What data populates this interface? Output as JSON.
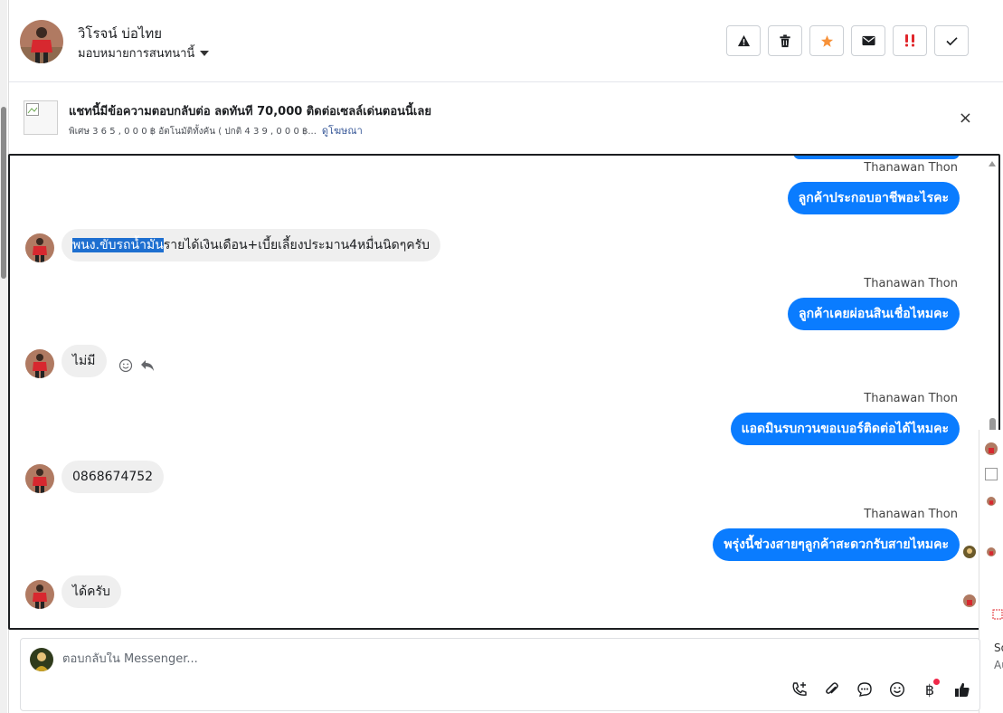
{
  "header": {
    "contact_name": "วิโรจน์ บ่อไทย",
    "assign_label": "มอบหมายการสนทนานี้",
    "actions": [
      {
        "name": "spam-button",
        "icon": "warning-icon"
      },
      {
        "name": "delete-button",
        "icon": "trash-icon"
      },
      {
        "name": "star-button",
        "icon": "star-icon"
      },
      {
        "name": "mark-unread-button",
        "icon": "envelope-icon"
      },
      {
        "name": "follow-up-button",
        "icon": "follow-up-icon"
      },
      {
        "name": "done-button",
        "icon": "check-icon"
      }
    ]
  },
  "ad": {
    "title": "แชทนี้มีข้อความตอบกลับต่อ ลดทันที 70,000 ติดต่อเซลล์เด่นตอนนี้เลย",
    "subtitle": "พิเศษ 3 6 5 , 0 0 0 ฿ อัตโนมัติทั้งคัน ( ปกติ 4 3 9 , 0 0 0 ฿...",
    "link": "ดูโฆษณา",
    "close": "×"
  },
  "chat": {
    "messages": [
      {
        "dir": "out",
        "sender": "Thanawan Thon",
        "text": "ลูกค้าประกอบอาชีพอะไรคะ"
      },
      {
        "dir": "in",
        "highlight": "พนง.ขับรถน้ำมัน",
        "text": "รายได้เงินเดือน+เบี้ยเลี้ยงประมาน4หมื่นนิดๆครับ"
      },
      {
        "dir": "out",
        "sender": "Thanawan Thon",
        "text": "ลูกค้าเคยผ่อนสินเชื่อไหมคะ"
      },
      {
        "dir": "in",
        "text": "ไม่มี"
      },
      {
        "dir": "out",
        "sender": "Thanawan Thon",
        "text": "แอดมินรบกวนขอเบอร์ติดต่อได้ไหมคะ"
      },
      {
        "dir": "in",
        "text": "0868674752"
      },
      {
        "dir": "out",
        "sender": "Thanawan Thon",
        "text": "พรุ่งนี้ช่วงสายๆลูกค้าสะดวกรับสายไหมคะ"
      },
      {
        "dir": "in",
        "text": "ได้ครับ"
      }
    ]
  },
  "side_peek": {
    "line1": "So",
    "line2": "Au"
  },
  "composer": {
    "placeholder": "ตอบกลับใน Messenger...",
    "tools": [
      "call-add-icon",
      "attach-icon",
      "saved-reply-icon",
      "emoji-icon",
      "baht-icon",
      "like-icon"
    ]
  },
  "colors": {
    "accent": "#0a7cff",
    "highlight": "#1e6fd0",
    "incoming": "#efefef",
    "star": "#f7923a",
    "follow_up": "#e0262b"
  }
}
